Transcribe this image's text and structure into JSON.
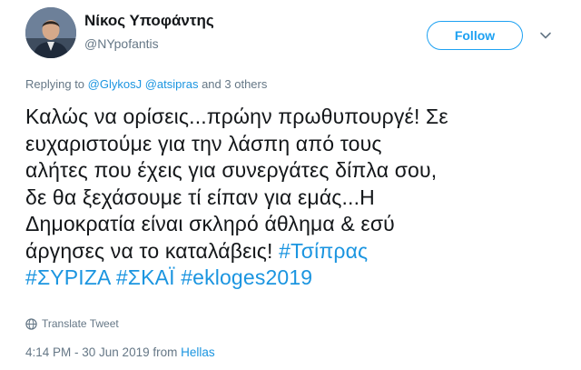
{
  "user": {
    "display_name": "Νίκος Υποφάντης",
    "handle": "@NYpofantis"
  },
  "follow_label": "Follow",
  "reply": {
    "prefix": "Replying to",
    "mentions": [
      "@GlykosJ",
      "@atsipras"
    ],
    "suffix": "and 3 others"
  },
  "tweet": {
    "line1": "Καλώς να ορίσεις...πρώην πρωθυπουργέ! Σε",
    "line2": "ευχαριστούμε για την λάσπη από τους",
    "line3": "αλήτες που έχεις για συνεργάτες δίπλα σου,",
    "line4": "δε θα ξεχάσουμε τί είπαν για εμάς...Η",
    "line5_text": "Δημοκρατία είναι σκληρό άθλημα & εσύ",
    "line6_text": "άργησες να το καταλάβεις!",
    "hashtags": [
      "#Τσίπρας",
      "#ΣΥΡΙΖΑ",
      "#ΣΚΑΪ",
      "#ekloges2019"
    ]
  },
  "translate_label": "Translate Tweet",
  "timestamp": "4:14 PM - 30 Jun 2019 from",
  "location": "Hellas",
  "icons": {
    "avatar": "profile-photo",
    "chevron": "chevron-down-icon",
    "translate": "globe-icon"
  },
  "colors": {
    "brand_blue": "#1da1f2",
    "link_blue": "#1b95e0",
    "muted_gray": "#657786",
    "text_dark": "#14171a"
  }
}
